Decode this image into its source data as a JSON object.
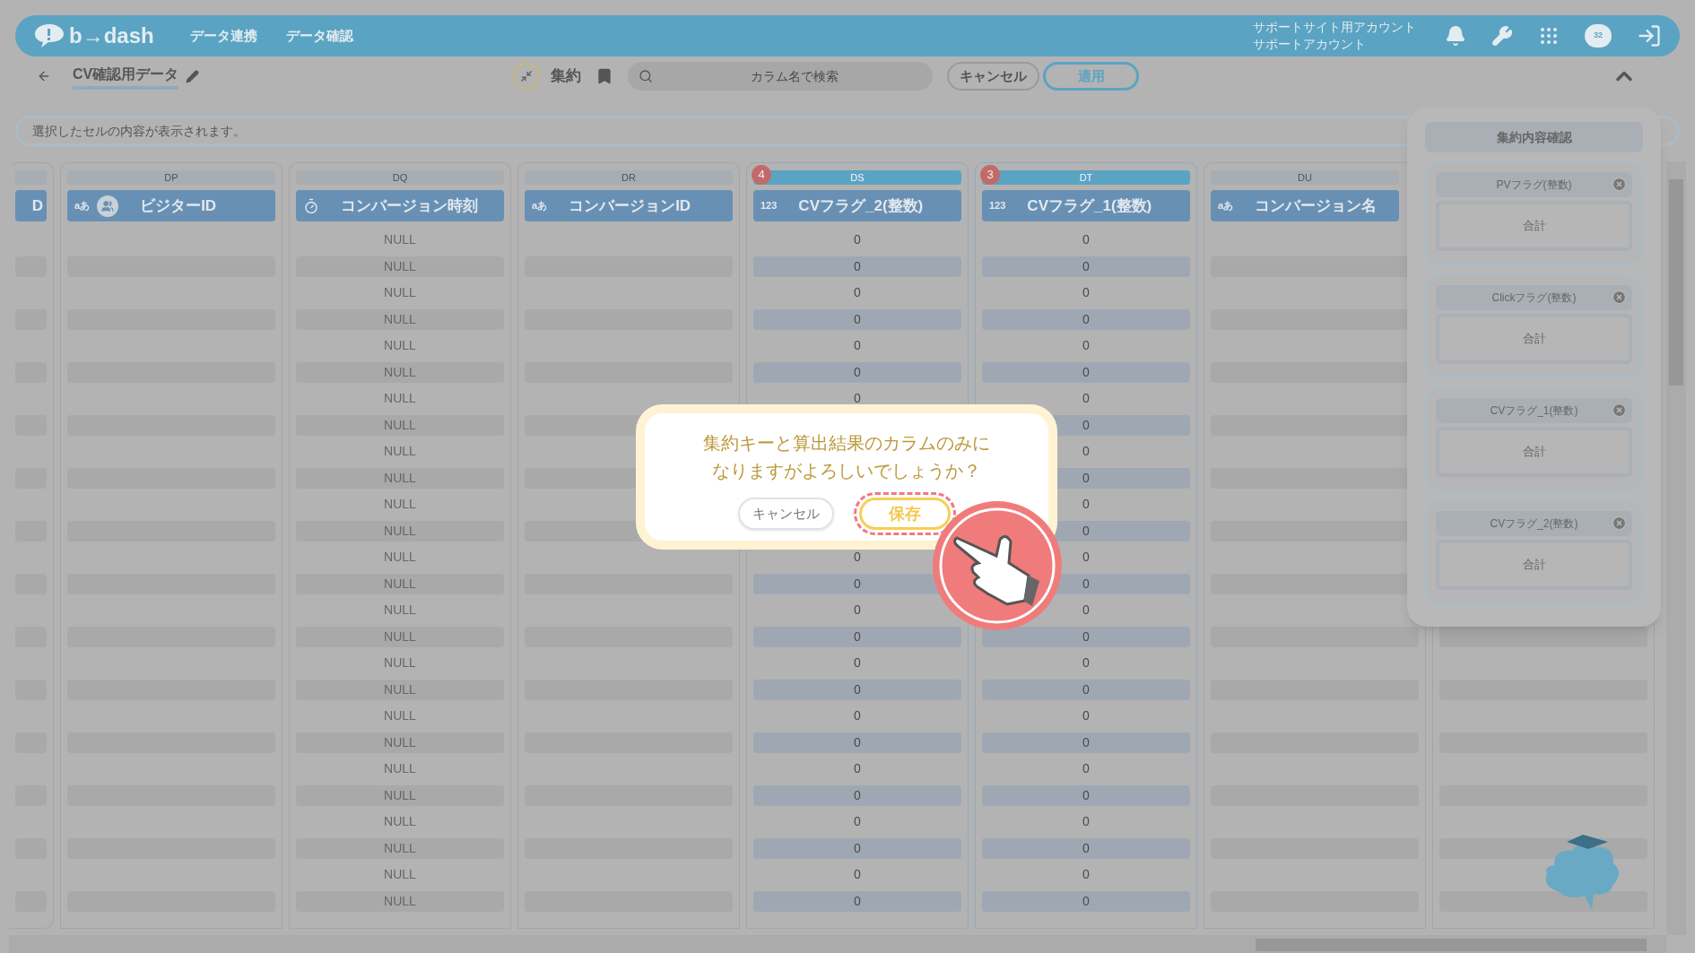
{
  "header": {
    "logo": "b→dash",
    "nav": [
      {
        "label": "データ連携"
      },
      {
        "label": "データ確認"
      }
    ],
    "account": [
      "サポートサイト用アカウント",
      "サポートアカウント"
    ],
    "chat_badge": "32"
  },
  "toolbar": {
    "title": "CV確認用データ",
    "mode": "集約",
    "search": {
      "placeholder": "カラム名で検索"
    },
    "cancel": "キャンセル",
    "apply": "適用"
  },
  "cell_info": {
    "placeholder": "選択したセルの内容が表示されます。"
  },
  "columns": [
    {
      "kind": "clipped",
      "name": "D",
      "selected": false
    },
    {
      "kind": "text",
      "letter": "DP",
      "name": "ビジターID",
      "type_label": "aあ",
      "people_icon": true,
      "selected": false
    },
    {
      "kind": "datetime",
      "letter": "DQ",
      "name": "コンバージョン時刻",
      "selected": false,
      "cells": [
        "NULL",
        "NULL",
        "NULL",
        "NULL",
        "NULL",
        "NULL",
        "NULL",
        "NULL",
        "NULL",
        "NULL",
        "NULL",
        "NULL",
        "NULL",
        "NULL",
        "NULL",
        "NULL",
        "NULL",
        "NULL",
        "NULL",
        "NULL",
        "NULL",
        "NULL",
        "NULL",
        "NULL",
        "NULL",
        "NULL"
      ]
    },
    {
      "kind": "text",
      "letter": "DR",
      "name": "コンバージョンID",
      "type_label": "aあ",
      "selected": false
    },
    {
      "kind": "number",
      "letter": "DS",
      "name": "CVフラグ_2(整数)",
      "type_label": "123",
      "badge": "4",
      "selected": true,
      "cells": [
        "0",
        "0",
        "0",
        "0",
        "0",
        "0",
        "0",
        null,
        null,
        null,
        null,
        null,
        "0",
        "0",
        "0",
        "0",
        "0",
        "0",
        "0",
        "0",
        "0",
        "0",
        "0",
        "0",
        "0",
        "0"
      ]
    },
    {
      "kind": "number",
      "letter": "DT",
      "name": "CVフラグ_1(整数)",
      "type_label": "123",
      "badge": "3",
      "selected": true,
      "cells": [
        "0",
        "0",
        "0",
        "0",
        "0",
        "0",
        "0",
        "0",
        "0",
        "0",
        "0",
        "0",
        "0",
        "0",
        "0",
        "0",
        "0",
        "0",
        "0",
        "0",
        "0",
        "0",
        "0",
        "0",
        "0",
        "0"
      ]
    },
    {
      "kind": "text",
      "letter": "DU",
      "name": "コンバージョン名",
      "type_label": "aあ",
      "selected": false
    },
    {
      "kind": "covered",
      "selected": false
    }
  ],
  "panel": {
    "title": "集約内容確認",
    "items": [
      {
        "name": "PVフラグ(整数)",
        "method": "合計"
      },
      {
        "name": "Clickフラグ(整数)",
        "method": "合計"
      },
      {
        "name": "CVフラグ_1(整数)",
        "method": "合計"
      },
      {
        "name": "CVフラグ_2(整数)",
        "method": "合計"
      }
    ]
  },
  "dialog": {
    "message": [
      "集約キーと算出結果のカラムのみに",
      "なりますがよろしいでしょうか？"
    ],
    "cancel": "キャンセル",
    "save": "保存"
  }
}
